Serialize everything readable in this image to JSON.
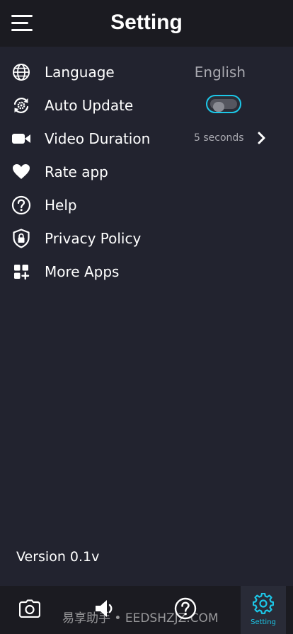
{
  "header": {
    "title": "Setting",
    "menu_icon": "hamburger-menu-icon"
  },
  "settings": {
    "language": {
      "icon": "globe-icon",
      "label": "Language",
      "value": "English"
    },
    "auto_update": {
      "icon": "refresh-gear-icon",
      "label": "Auto Update",
      "enabled": false
    },
    "video_duration": {
      "icon": "video-camera-icon",
      "label": "Video Duration",
      "value": "5 seconds",
      "chevron_icon": "chevron-right-icon"
    },
    "rate_app": {
      "icon": "heart-icon",
      "label": "Rate app"
    },
    "help": {
      "icon": "question-circle-icon",
      "label": "Help"
    },
    "privacy_policy": {
      "icon": "shield-lock-icon",
      "label": "Privacy Policy"
    },
    "more_apps": {
      "icon": "apps-grid-plus-icon",
      "label": "More Apps"
    }
  },
  "footer": {
    "version": "Version 0.1v"
  },
  "bottom_nav": {
    "items": [
      {
        "icon": "camera-icon",
        "label": ""
      },
      {
        "icon": "speaker-icon",
        "label": ""
      },
      {
        "icon": "help-icon",
        "label": ""
      },
      {
        "icon": "gear-icon",
        "label": "Setting",
        "active": true
      }
    ]
  },
  "watermark": "易享助手 • EEDSHZJZ.COM",
  "colors": {
    "background": "#22232f",
    "bar_background": "#1b1b21",
    "accent": "#1cc7e8",
    "muted_text": "#a9a9b0"
  }
}
